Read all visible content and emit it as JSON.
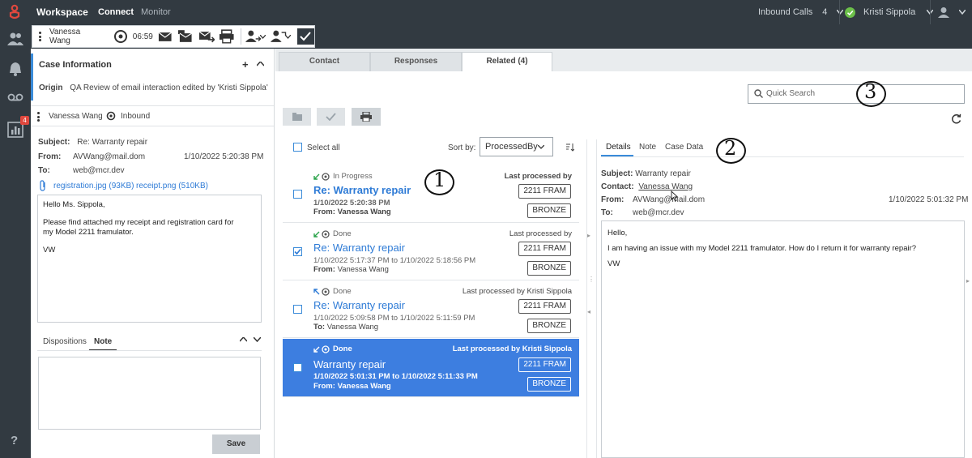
{
  "topbar": {
    "brand": "Workspace",
    "tabs": [
      "Connect",
      "Monitor"
    ],
    "inbound_label": "Inbound Calls",
    "inbound_count": "4",
    "user": "Kristi Sippola"
  },
  "leftnav": {
    "badge": "4",
    "help": "?"
  },
  "interaction_toolbar": {
    "contact": "Vanessa Wang",
    "timer": "06:59"
  },
  "case": {
    "title": "Case Information",
    "add": "+",
    "collapse": "^",
    "origin_label": "Origin",
    "origin_text": "QA Review of email interaction edited by 'Kristi Sippola'",
    "contact": "Vanessa Wang",
    "direction": "Inbound"
  },
  "email": {
    "subject_label": "Subject:",
    "subject": "Re: Warranty repair",
    "from_label": "From:",
    "from": "AVWang@mail.dom",
    "date": "1/10/2022 5:20:38 PM",
    "to_label": "To:",
    "to": "web@mcr.dev",
    "attachments": [
      "registration.jpg (93KB)",
      "receipt.png (510KB)"
    ],
    "body": [
      "Hello Ms. Sippola,",
      "Please find attached my receipt and registration card for my Model 2211 framulator.",
      "VW"
    ]
  },
  "dispositions": {
    "tabs": [
      "Dispositions",
      "Note"
    ],
    "save_label": "Save"
  },
  "content_tabs": [
    {
      "label": "Contact"
    },
    {
      "label": "Responses"
    },
    {
      "label": "Related (4)"
    }
  ],
  "list": {
    "select_all": "Select all",
    "sort_by_label": "Sort by:",
    "sort_value": "ProcessedBy",
    "items": [
      {
        "status": "In Progress",
        "title": "Re: Warranty repair",
        "date": "1/10/2022 5:20:38 PM",
        "party_label": "From:",
        "party": "Vanessa Wang",
        "last_processed": "Last processed by",
        "tags": [
          "2211 FRAM",
          "BRONZE"
        ]
      },
      {
        "status": "Done",
        "title": "Re: Warranty repair",
        "date": "1/10/2022 5:17:37 PM to 1/10/2022 5:18:56 PM",
        "party_label": "From:",
        "party": "Vanessa Wang",
        "last_processed": "Last processed by",
        "tags": [
          "2211 FRAM",
          "BRONZE"
        ]
      },
      {
        "status": "Done",
        "title": "Re: Warranty repair",
        "date": "1/10/2022 5:09:58 PM to 1/10/2022 5:11:59 PM",
        "party_label": "To:",
        "party": "Vanessa Wang",
        "last_processed": "Last processed by Kristi Sippola",
        "tags": [
          "2211 FRAM",
          "BRONZE"
        ]
      },
      {
        "status": "Done",
        "title": "Warranty repair",
        "date": "1/10/2022 5:01:31 PM to 1/10/2022 5:11:33 PM",
        "party_label": "From:",
        "party": "Vanessa Wang",
        "last_processed": "Last processed by Kristi Sippola",
        "tags": [
          "2211 FRAM",
          "BRONZE"
        ]
      }
    ]
  },
  "details": {
    "tabs": [
      "Details",
      "Note",
      "Case Data"
    ],
    "subject_label": "Subject:",
    "subject": "Warranty repair",
    "contact_label": "Contact:",
    "contact": "Vanessa Wang",
    "from_label": "From:",
    "from": "AVWang@mail.dom",
    "date": "1/10/2022 5:01:32 PM",
    "to_label": "To:",
    "to": "web@mcr.dev",
    "body": [
      "Hello,",
      "I am having an issue with my Model 2211 framulator. How do I return it for warranty repair?",
      "VW"
    ]
  },
  "search": {
    "placeholder": "Quick Search"
  },
  "annotations": [
    "1",
    "2",
    "3"
  ],
  "colors": {
    "topbar": "#323a41",
    "accent": "#3a8bd9",
    "selected_row": "#3d7ee0",
    "status_ok": "#6cc04a",
    "brand_logo": "#e0483e"
  }
}
